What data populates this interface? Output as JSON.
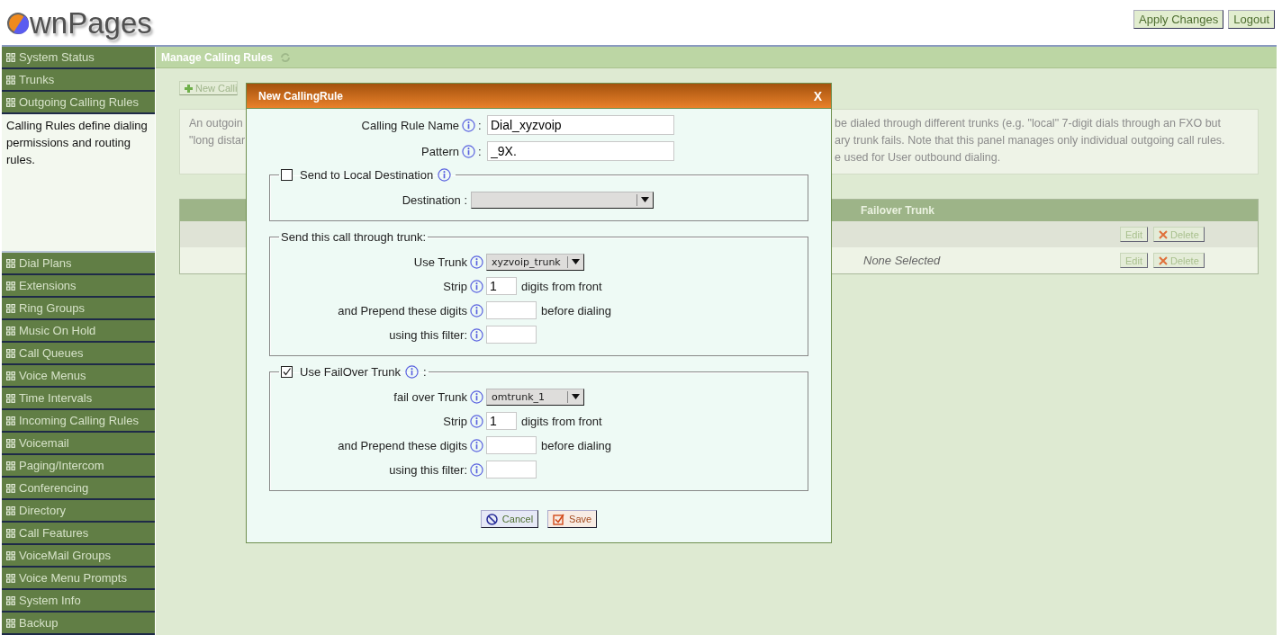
{
  "header": {
    "logo": "wnPages",
    "buttons": [
      "Apply Changes",
      "Logout"
    ]
  },
  "sidebar": {
    "items": [
      {
        "label": "System Status"
      },
      {
        "label": "Trunks"
      },
      {
        "label": "Outgoing Calling Rules",
        "description": "Calling Rules define dialing permissions and routing rules."
      },
      {
        "label": "Dial Plans"
      },
      {
        "label": "Extensions"
      },
      {
        "label": "Ring Groups"
      },
      {
        "label": "Music On Hold"
      },
      {
        "label": "Call Queues"
      },
      {
        "label": "Voice Menus"
      },
      {
        "label": "Time Intervals"
      },
      {
        "label": "Incoming Calling Rules"
      },
      {
        "label": "Voicemail"
      },
      {
        "label": "Paging/Intercom"
      },
      {
        "label": "Conferencing"
      },
      {
        "label": "Directory"
      },
      {
        "label": "Call Features"
      },
      {
        "label": "VoiceMail Groups"
      },
      {
        "label": "Voice Menu Prompts"
      },
      {
        "label": "System Info"
      },
      {
        "label": "Backup"
      }
    ]
  },
  "main": {
    "title": "Manage Calling Rules",
    "new_button": "New Calli",
    "description": {
      "left_lines": [
        "An outgoin",
        "\"long distar"
      ],
      "right_lines": [
        "be dialed through different trunks (e.g. \"local\" 7-digit dials through an FXO but",
        "ary trunk fails. Note that this panel manages only individual outgoing call rules.",
        "e used for User outbound dialing."
      ]
    },
    "table": {
      "columns": [
        "Failover Trunk"
      ],
      "rows": [
        {
          "actions": [
            "Edit",
            "Delete"
          ]
        },
        {
          "failover_trunk": "None Selected",
          "actions": [
            "Edit",
            "Delete"
          ]
        }
      ]
    }
  },
  "dialog": {
    "title": "New CallingRule",
    "close": "X",
    "fields": [
      {
        "label": "Calling Rule Name",
        "separator": ":",
        "value": "Dial_xyzvoip"
      },
      {
        "label": "Pattern",
        "separator": ":",
        "value": "_9X."
      }
    ],
    "sections": [
      {
        "kind": "checkable",
        "label": "Send to Local Destination",
        "checked": false,
        "rows": [
          {
            "kind": "dropdown",
            "label": "Destination :",
            "wide": true
          }
        ]
      },
      {
        "kind": "plain",
        "label": "Send this call through trunk:",
        "rows": [
          {
            "kind": "dropdown",
            "label": "Use Trunk",
            "value": "xyzvoip_trunk"
          },
          {
            "kind": "input",
            "label": "Strip",
            "value": "1",
            "suffix": "digits from front"
          },
          {
            "kind": "input",
            "label": "and Prepend these digits",
            "suffix": "before dialing"
          },
          {
            "kind": "input",
            "label": "using this filter:"
          }
        ]
      },
      {
        "kind": "checkable",
        "label": "Use FailOver Trunk",
        "checked": true,
        "separator": ":",
        "rows": [
          {
            "kind": "dropdown",
            "label": "fail over Trunk",
            "value": "omtrunk_1"
          },
          {
            "kind": "input",
            "label": "Strip",
            "value": "1",
            "suffix": "digits from front"
          },
          {
            "kind": "input",
            "label": "and Prepend these digits",
            "suffix": "before dialing"
          },
          {
            "kind": "input",
            "label": "using this filter:"
          }
        ]
      }
    ],
    "buttons": [
      {
        "kind": "cancel",
        "label": "Cancel"
      },
      {
        "kind": "save",
        "label": "Save"
      }
    ]
  }
}
